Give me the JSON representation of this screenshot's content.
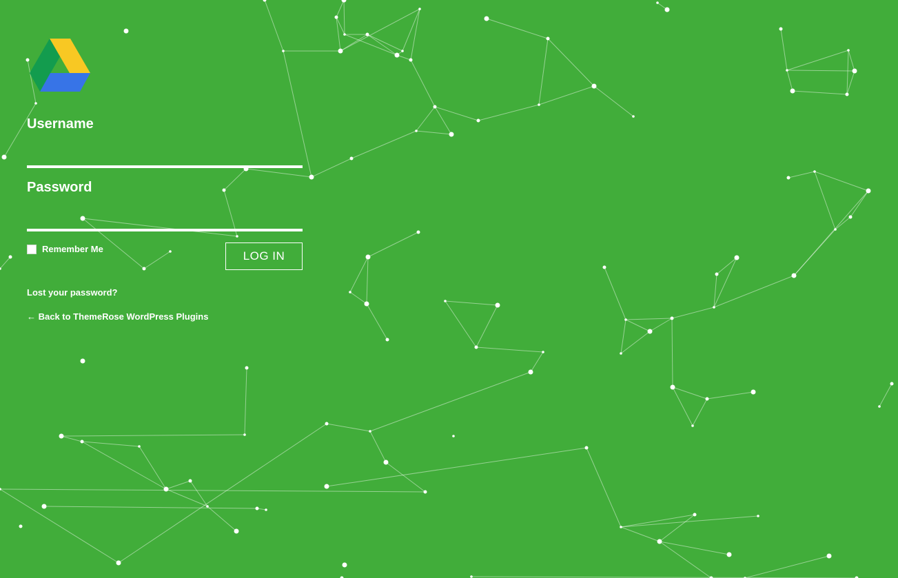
{
  "theme": {
    "background": "#41ad3a",
    "foreground": "#ffffff",
    "logo_colors": {
      "yellow": "#f8c823",
      "green": "#139c4e",
      "blue": "#3774e7"
    }
  },
  "logo": {
    "icon": "google-drive-icon"
  },
  "form": {
    "username_label": "Username",
    "username_value": "",
    "password_label": "Password",
    "password_value": "",
    "remember_label": "Remember Me",
    "remember_checked": false,
    "submit_label": "LOG IN"
  },
  "links": {
    "lost_password": "Lost your password?",
    "back_to_site": "← Back to ThemeRose WordPress Plugins"
  }
}
